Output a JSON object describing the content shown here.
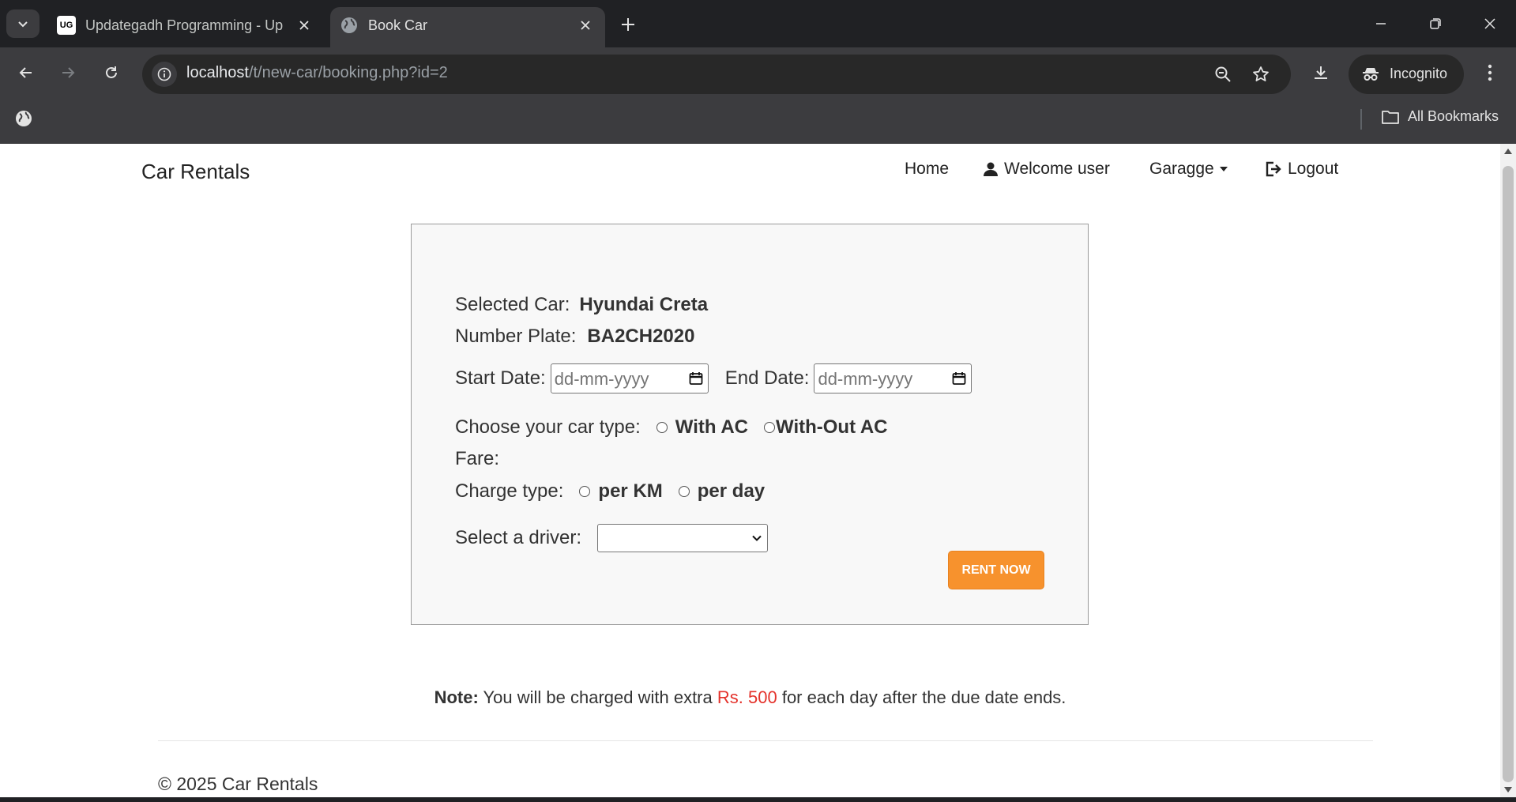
{
  "browser": {
    "tabs": [
      {
        "title": "Updategadh Programming - Up",
        "active": false,
        "favicon_text": "UG"
      },
      {
        "title": "Book Car",
        "active": true
      }
    ],
    "url_host": "localhost",
    "url_path": "/t/new-car/booking.php?id=2",
    "incognito_label": "Incognito",
    "bookmarks_label": "All Bookmarks"
  },
  "site": {
    "brand": "Car Rentals",
    "nav": {
      "home": "Home",
      "welcome": "Welcome user",
      "garage": "Garagge",
      "logout": "Logout"
    }
  },
  "booking": {
    "selected_car_label": "Selected Car:",
    "selected_car_value": "Hyundai Creta",
    "number_plate_label": "Number Plate:",
    "number_plate_value": "BA2CH2020",
    "start_date_label": "Start Date:",
    "end_date_label": "End Date:",
    "date_placeholder": "dd-mm-yyyy",
    "car_type_label": "Choose your car type:",
    "car_type_options": [
      "With AC",
      "With-Out AC"
    ],
    "fare_label": "Fare:",
    "charge_type_label": "Charge type:",
    "charge_type_options": [
      "per KM",
      "per day"
    ],
    "driver_label": "Select a driver:",
    "driver_selected": "",
    "rent_button": "RENT NOW"
  },
  "note": {
    "bold": "Note:",
    "text_before": "You will be charged with extra",
    "amount": "Rs. 500",
    "text_after": "for each day after the due date ends."
  },
  "footer": "© 2025 Car Rentals",
  "colors": {
    "accent_button": "#f7922d",
    "note_amount": "#e4322b"
  }
}
